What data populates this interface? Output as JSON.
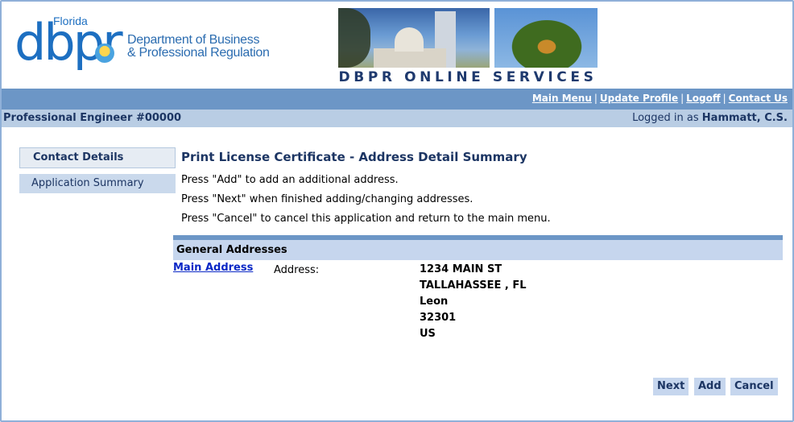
{
  "logo": {
    "state": "Florida",
    "brand": "dbpr",
    "dept_line1": "Department of Business",
    "dept_line2": "& Professional Regulation"
  },
  "banner": {
    "text": "DBPR ONLINE SERVICES"
  },
  "nav": {
    "links": [
      "Main Menu",
      "Update Profile",
      "Logoff",
      "Contact Us"
    ],
    "separator": "|"
  },
  "info": {
    "profession": "Professional Engineer #00000",
    "logged_prefix": "Logged in as",
    "user": "Hammatt, C.S."
  },
  "sidebar": {
    "items": [
      {
        "label": "Contact Details"
      },
      {
        "label": "Application Summary"
      }
    ]
  },
  "main": {
    "title": "Print License Certificate - Address Detail Summary",
    "instructions": [
      "Press \"Add\" to add an additional address.",
      "Press \"Next\" when finished adding/changing addresses.",
      "Press \"Cancel\" to cancel this application and return to the main menu."
    ],
    "section_title": "General Addresses",
    "address": {
      "link": "Main Address",
      "label": "Address:",
      "lines": [
        "1234 MAIN ST",
        "TALLAHASSEE , FL",
        "Leon",
        "32301",
        "US"
      ]
    }
  },
  "buttons": {
    "next": "Next",
    "add": "Add",
    "cancel": "Cancel"
  },
  "colors": {
    "navbar": "#6c96c6",
    "infobar": "#b9cde4",
    "brand_blue": "#1d6fc1",
    "link": "#0b28c6"
  }
}
